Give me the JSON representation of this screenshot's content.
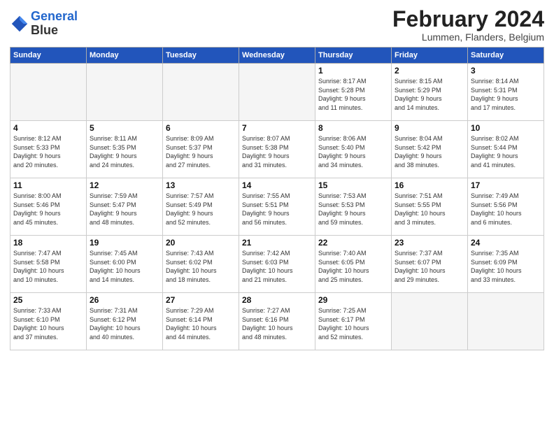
{
  "header": {
    "logo_line1": "General",
    "logo_line2": "Blue",
    "month_title": "February 2024",
    "subtitle": "Lummen, Flanders, Belgium"
  },
  "weekdays": [
    "Sunday",
    "Monday",
    "Tuesday",
    "Wednesday",
    "Thursday",
    "Friday",
    "Saturday"
  ],
  "weeks": [
    [
      {
        "day": "",
        "info": ""
      },
      {
        "day": "",
        "info": ""
      },
      {
        "day": "",
        "info": ""
      },
      {
        "day": "",
        "info": ""
      },
      {
        "day": "1",
        "info": "Sunrise: 8:17 AM\nSunset: 5:28 PM\nDaylight: 9 hours\nand 11 minutes."
      },
      {
        "day": "2",
        "info": "Sunrise: 8:15 AM\nSunset: 5:29 PM\nDaylight: 9 hours\nand 14 minutes."
      },
      {
        "day": "3",
        "info": "Sunrise: 8:14 AM\nSunset: 5:31 PM\nDaylight: 9 hours\nand 17 minutes."
      }
    ],
    [
      {
        "day": "4",
        "info": "Sunrise: 8:12 AM\nSunset: 5:33 PM\nDaylight: 9 hours\nand 20 minutes."
      },
      {
        "day": "5",
        "info": "Sunrise: 8:11 AM\nSunset: 5:35 PM\nDaylight: 9 hours\nand 24 minutes."
      },
      {
        "day": "6",
        "info": "Sunrise: 8:09 AM\nSunset: 5:37 PM\nDaylight: 9 hours\nand 27 minutes."
      },
      {
        "day": "7",
        "info": "Sunrise: 8:07 AM\nSunset: 5:38 PM\nDaylight: 9 hours\nand 31 minutes."
      },
      {
        "day": "8",
        "info": "Sunrise: 8:06 AM\nSunset: 5:40 PM\nDaylight: 9 hours\nand 34 minutes."
      },
      {
        "day": "9",
        "info": "Sunrise: 8:04 AM\nSunset: 5:42 PM\nDaylight: 9 hours\nand 38 minutes."
      },
      {
        "day": "10",
        "info": "Sunrise: 8:02 AM\nSunset: 5:44 PM\nDaylight: 9 hours\nand 41 minutes."
      }
    ],
    [
      {
        "day": "11",
        "info": "Sunrise: 8:00 AM\nSunset: 5:46 PM\nDaylight: 9 hours\nand 45 minutes."
      },
      {
        "day": "12",
        "info": "Sunrise: 7:59 AM\nSunset: 5:47 PM\nDaylight: 9 hours\nand 48 minutes."
      },
      {
        "day": "13",
        "info": "Sunrise: 7:57 AM\nSunset: 5:49 PM\nDaylight: 9 hours\nand 52 minutes."
      },
      {
        "day": "14",
        "info": "Sunrise: 7:55 AM\nSunset: 5:51 PM\nDaylight: 9 hours\nand 56 minutes."
      },
      {
        "day": "15",
        "info": "Sunrise: 7:53 AM\nSunset: 5:53 PM\nDaylight: 9 hours\nand 59 minutes."
      },
      {
        "day": "16",
        "info": "Sunrise: 7:51 AM\nSunset: 5:55 PM\nDaylight: 10 hours\nand 3 minutes."
      },
      {
        "day": "17",
        "info": "Sunrise: 7:49 AM\nSunset: 5:56 PM\nDaylight: 10 hours\nand 6 minutes."
      }
    ],
    [
      {
        "day": "18",
        "info": "Sunrise: 7:47 AM\nSunset: 5:58 PM\nDaylight: 10 hours\nand 10 minutes."
      },
      {
        "day": "19",
        "info": "Sunrise: 7:45 AM\nSunset: 6:00 PM\nDaylight: 10 hours\nand 14 minutes."
      },
      {
        "day": "20",
        "info": "Sunrise: 7:43 AM\nSunset: 6:02 PM\nDaylight: 10 hours\nand 18 minutes."
      },
      {
        "day": "21",
        "info": "Sunrise: 7:42 AM\nSunset: 6:03 PM\nDaylight: 10 hours\nand 21 minutes."
      },
      {
        "day": "22",
        "info": "Sunrise: 7:40 AM\nSunset: 6:05 PM\nDaylight: 10 hours\nand 25 minutes."
      },
      {
        "day": "23",
        "info": "Sunrise: 7:37 AM\nSunset: 6:07 PM\nDaylight: 10 hours\nand 29 minutes."
      },
      {
        "day": "24",
        "info": "Sunrise: 7:35 AM\nSunset: 6:09 PM\nDaylight: 10 hours\nand 33 minutes."
      }
    ],
    [
      {
        "day": "25",
        "info": "Sunrise: 7:33 AM\nSunset: 6:10 PM\nDaylight: 10 hours\nand 37 minutes."
      },
      {
        "day": "26",
        "info": "Sunrise: 7:31 AM\nSunset: 6:12 PM\nDaylight: 10 hours\nand 40 minutes."
      },
      {
        "day": "27",
        "info": "Sunrise: 7:29 AM\nSunset: 6:14 PM\nDaylight: 10 hours\nand 44 minutes."
      },
      {
        "day": "28",
        "info": "Sunrise: 7:27 AM\nSunset: 6:16 PM\nDaylight: 10 hours\nand 48 minutes."
      },
      {
        "day": "29",
        "info": "Sunrise: 7:25 AM\nSunset: 6:17 PM\nDaylight: 10 hours\nand 52 minutes."
      },
      {
        "day": "",
        "info": ""
      },
      {
        "day": "",
        "info": ""
      }
    ]
  ]
}
